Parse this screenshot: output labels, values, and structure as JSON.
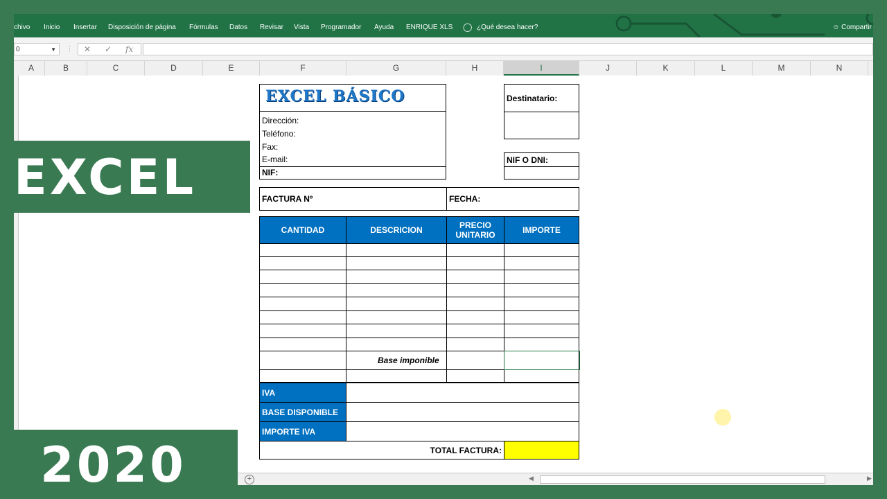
{
  "ribbon": {
    "tabs": [
      "chivo",
      "Inicio",
      "Insertar",
      "Disposición de página",
      "Fórmulas",
      "Datos",
      "Revisar",
      "Vista",
      "Programador",
      "Ayuda",
      "ENRIQUE XLS"
    ],
    "tell_me": "¿Qué desea hacer?",
    "share": "Compartir"
  },
  "formula_bar": {
    "name_box": "0",
    "fx": "fx",
    "content": ""
  },
  "columns": [
    "A",
    "B",
    "C",
    "D",
    "E",
    "F",
    "G",
    "H",
    "I",
    "J",
    "K",
    "L",
    "M",
    "N"
  ],
  "selected_column": "I",
  "overlay": {
    "excel": "EXCEL",
    "year": "2020"
  },
  "invoice": {
    "title": "EXCEL BÁSICO",
    "address_label": "Dirección:",
    "phone_label": "Teléfono:",
    "fax_label": "Fax:",
    "email_label": "E-mail:",
    "nif_label": "NIF:",
    "recipient_label": "Destinatario:",
    "nif_dni_label": "NIF O DNI:",
    "invoice_no_label": "FACTURA Nº",
    "date_label": "FECHA:",
    "headers": {
      "qty": "CANTIDAD",
      "desc": "DESCRICION",
      "unit_price": "PRECIO UNITARIO",
      "amount": "IMPORTE"
    },
    "taxable_base": "Base imponible",
    "iva": "IVA",
    "base_available": "BASE DISPONIBLE",
    "iva_amount": "IMPORTE IVA",
    "total": "TOTAL FACTURA:",
    "total_color": "#ffff00",
    "header_color": "#0070c0"
  }
}
